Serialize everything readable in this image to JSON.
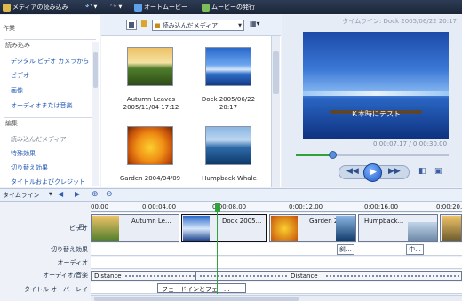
{
  "toolbar": {
    "import_media": "メディアの読み込み",
    "automovie": "オートムービー",
    "publish_movie": "ムービーの発行"
  },
  "taskpane": {
    "header_tasks": "作業",
    "header_import": "読み込み",
    "import_items": [
      "デジタル ビデオ カメラから",
      "ビデオ",
      "画像",
      "オーディオまたは音楽"
    ],
    "header_edit": "編集",
    "edit_items": [
      "読み込んだメディア",
      "特殊効果",
      "切り替え効果",
      "タイトルおよびクレジット"
    ]
  },
  "collection": {
    "dropdown_label": "読み込んだメディア",
    "items": [
      {
        "caption_line1": "Autumn Leaves",
        "caption_line2": "2005/11/04 17:12",
        "thumb": "autumn-leaves"
      },
      {
        "caption_line1": "Dock 2005/06/22",
        "caption_line2": "20:17",
        "thumb": "dock"
      },
      {
        "caption_line1": "Garden 2004/04/09",
        "caption_line2": "",
        "thumb": "garden"
      },
      {
        "caption_line1": "Humpback Whale",
        "caption_line2": "",
        "thumb": "humpback-whale"
      }
    ]
  },
  "preview": {
    "title": "タイムライン: Dock 2005/06/22 20:17",
    "overlay_text": "Ｋ本時にテスト",
    "time_readout": "0:00:07.17 / 0:00:30.00",
    "seek_fraction": 0.24
  },
  "timeline": {
    "view_label": "タイムライン",
    "ticks": [
      "00.00",
      "0:00:04.00",
      "0:00:08.00",
      "0:00:12.00",
      "0:00:16.00",
      "0:00:20.0"
    ],
    "tracks": {
      "video": "ビデオ",
      "transition": "切り替え効果",
      "audio": "オーディオ",
      "audio_music": "オーディオ/音楽",
      "title_overlay": "タイトル オーバーレイ"
    },
    "video_clips": [
      "Autumn Le...",
      "Dock 2005...",
      "Garden 20...",
      "Humpback..."
    ],
    "transition_labels": [
      "斜...",
      "中..."
    ],
    "audio_clips": [
      "Distance",
      "Distance"
    ],
    "title_clip": "フェードインとフェー...",
    "collapse_indicator": "日"
  },
  "colors": {
    "toolbar_bg": "#1b2538",
    "link_blue": "#1c55b3",
    "playhead_green": "#2fa33a"
  }
}
